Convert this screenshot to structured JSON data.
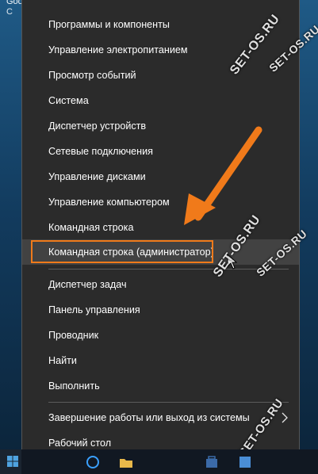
{
  "desktop": {
    "line1": "Google",
    "line2": "C"
  },
  "menu": {
    "items_group1": [
      "Программы и компоненты",
      "Управление электропитанием",
      "Просмотр событий",
      "Система",
      "Диспетчер устройств",
      "Сетевые подключения",
      "Управление дисками",
      "Управление компьютером",
      "Командная строка",
      "Командная строка (администратор)"
    ],
    "items_group2": [
      "Диспетчер задач",
      "Панель управления",
      "Проводник",
      "Найти",
      "Выполнить"
    ],
    "items_group3": [
      "Завершение работы или выход из системы",
      "Рабочий стол"
    ]
  },
  "watermark": {
    "text": "SET-OS.RU"
  },
  "colors": {
    "menu_bg": "#2b2b2b",
    "accent_orange": "#f07a1a",
    "hover_bg": "#424242"
  }
}
